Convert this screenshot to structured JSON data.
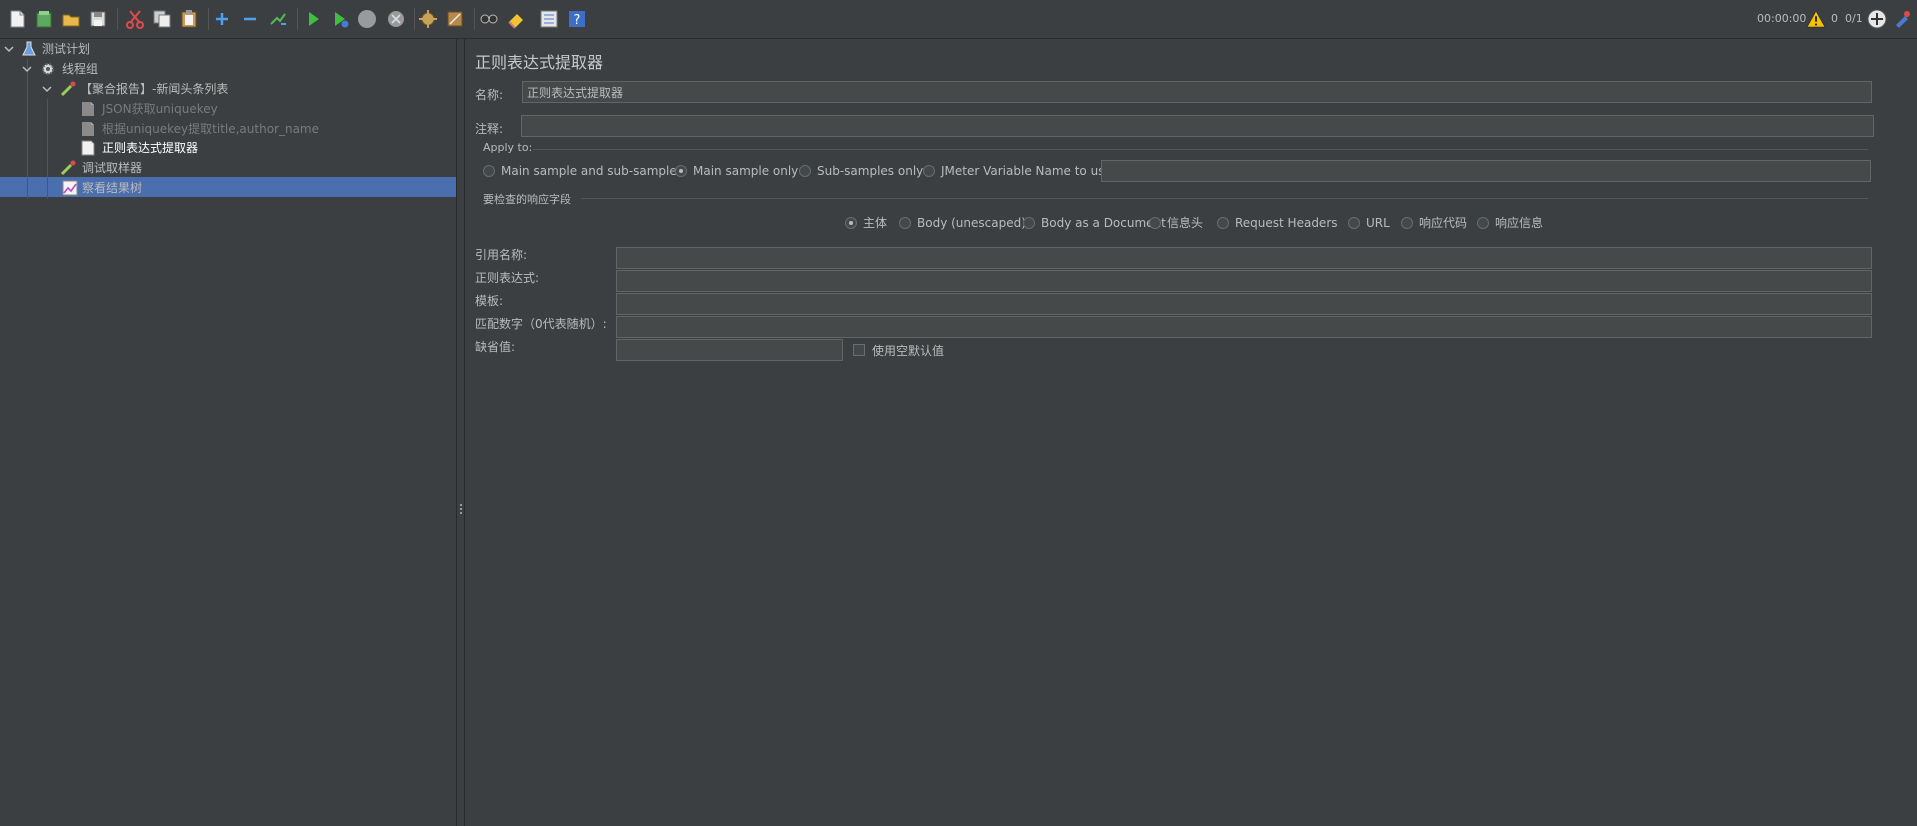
{
  "status": {
    "timer": "00:00:00",
    "warnings": "0",
    "threads": "0/1"
  },
  "tree": {
    "items": [
      {
        "label": "测试计划"
      },
      {
        "label": "线程组"
      },
      {
        "label": "【聚合报告】-新闻头条列表"
      },
      {
        "label": "JSON获取uniquekey"
      },
      {
        "label": "根据uniquekey提取title,author_name"
      },
      {
        "label": "正则表达式提取器"
      },
      {
        "label": "调试取样器"
      },
      {
        "label": "察看结果树"
      }
    ]
  },
  "panel": {
    "title": "正则表达式提取器",
    "name_label": "名称:",
    "name_value": "正则表达式提取器",
    "comment_label": "注释:",
    "comment_value": "",
    "apply_to": {
      "legend": "Apply to:",
      "options": [
        "Main sample and sub-samples",
        "Main sample only",
        "Sub-samples only",
        "JMeter Variable Name to use"
      ],
      "selected": "Main sample only",
      "variable_value": ""
    },
    "field_to_check": {
      "legend": "要检查的响应字段",
      "options": [
        "主体",
        "Body (unescaped)",
        "Body as a Document",
        "信息头",
        "Request Headers",
        "URL",
        "响应代码",
        "响应信息"
      ],
      "selected": "主体"
    },
    "fields": {
      "ref_name_label": "引用名称:",
      "ref_name_value": "",
      "regex_label": "正则表达式:",
      "regex_value": "",
      "template_label": "模板:",
      "template_value": "",
      "match_no_label": "匹配数字（0代表随机）:",
      "match_no_value": "",
      "default_label": "缺省值:",
      "default_value": "",
      "use_empty_default_label": "使用空默认值"
    }
  },
  "colors": {
    "background": "#3c3f41",
    "selection": "#4b6eaf",
    "input": "#45494a"
  }
}
